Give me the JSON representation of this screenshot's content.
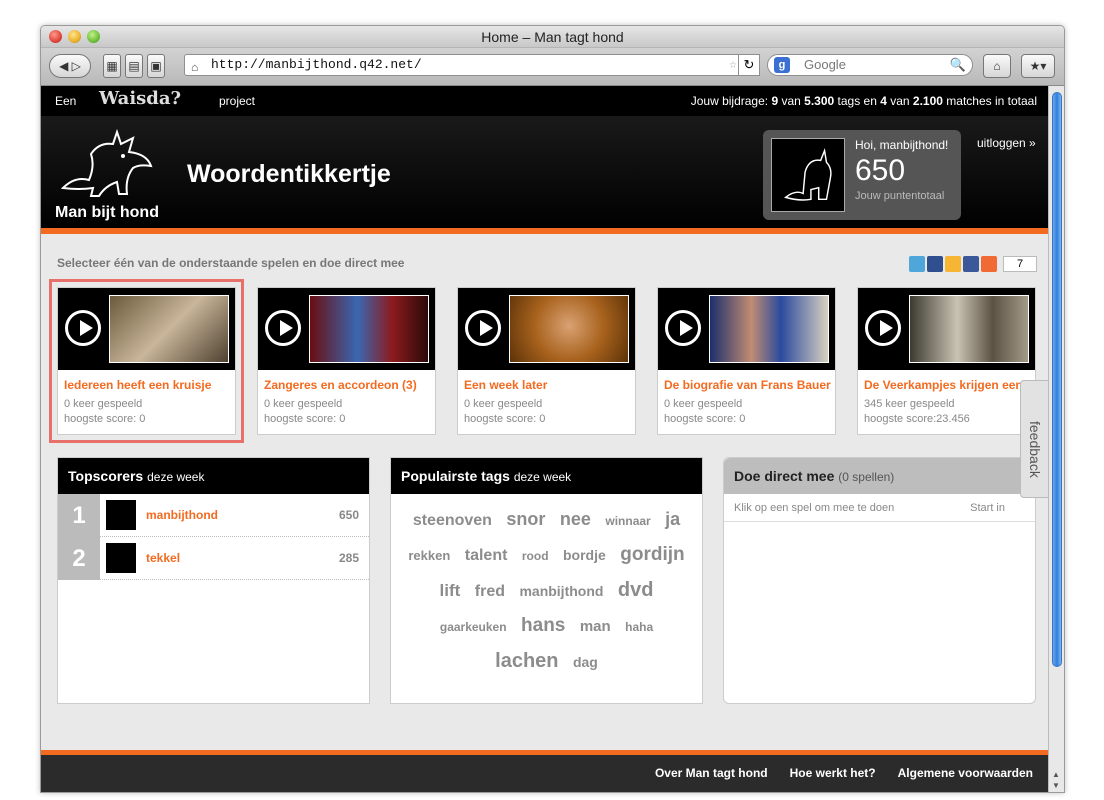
{
  "browser": {
    "window_title": "Home – Man tagt hond",
    "url": "http://manbijthond.q42.net/",
    "search_placeholder": "Google"
  },
  "topbar": {
    "een": "Een",
    "waisda": "Waisda?",
    "project": "project",
    "contribution_prefix": "Jouw bijdrage:",
    "tags_contributed": "9",
    "tags_total": "5.300",
    "matches_contributed": "4",
    "matches_total": "2.100",
    "contribution_text": "Jouw bijdrage: 9 van 5.300 tags en 4 van 2.100 matches in totaal"
  },
  "header": {
    "brand": "Man bijt hond",
    "game_title": "Woordentikkertje",
    "greeting": "Hoi, manbijthond!",
    "score": "650",
    "score_label": "Jouw puntentotaal",
    "logout": "uitloggen »"
  },
  "intro": "Selecteer één van de onderstaande spelen en doe direct mee",
  "share_count": "7",
  "games": [
    {
      "title": "Iedereen heeft een kruisje",
      "played": "0 keer gespeeld",
      "highscore": "hoogste score: 0",
      "selected": true
    },
    {
      "title": "Zangeres en accordeon (3)",
      "played": "0 keer gespeeld",
      "highscore": "hoogste score: 0"
    },
    {
      "title": "Een week later",
      "played": "0 keer gespeeld",
      "highscore": "hoogste score: 0"
    },
    {
      "title": "De biografie van Frans Bauer",
      "played": "0 keer gespeeld",
      "highscore": "hoogste score: 0"
    },
    {
      "title": "De Veerkampjes krijgen een",
      "played": "345 keer gespeeld",
      "highscore": "hoogste score:23.456"
    }
  ],
  "topscorers": {
    "title": "Topscorers",
    "subtitle": "deze week",
    "rows": [
      {
        "rank": "1",
        "name": "manbijthond",
        "score": "650"
      },
      {
        "rank": "2",
        "name": "tekkel",
        "score": "285"
      }
    ]
  },
  "tags_panel": {
    "title": "Populairste tags",
    "subtitle": "deze week",
    "tags": [
      "steenoven",
      "snor",
      "nee",
      "winnaar",
      "ja",
      "rekken",
      "talent",
      "rood",
      "bordje",
      "gordijn",
      "lift",
      "fred",
      "manbijthond",
      "dvd",
      "gaarkeuken",
      "hans",
      "man",
      "haha",
      "lachen",
      "dag"
    ]
  },
  "doe_panel": {
    "title": "Doe direct mee",
    "subtitle": "(0 spellen)",
    "left_label": "Klik op een spel om mee te doen",
    "right_label": "Start in"
  },
  "feedback": "feedback",
  "footer": {
    "links": [
      "Over Man tagt hond",
      "Hoe werkt het?",
      "Algemene voorwaarden"
    ]
  },
  "colors": {
    "accent": "#f36b21",
    "header": "#000000",
    "page": "#e9e9e9"
  }
}
